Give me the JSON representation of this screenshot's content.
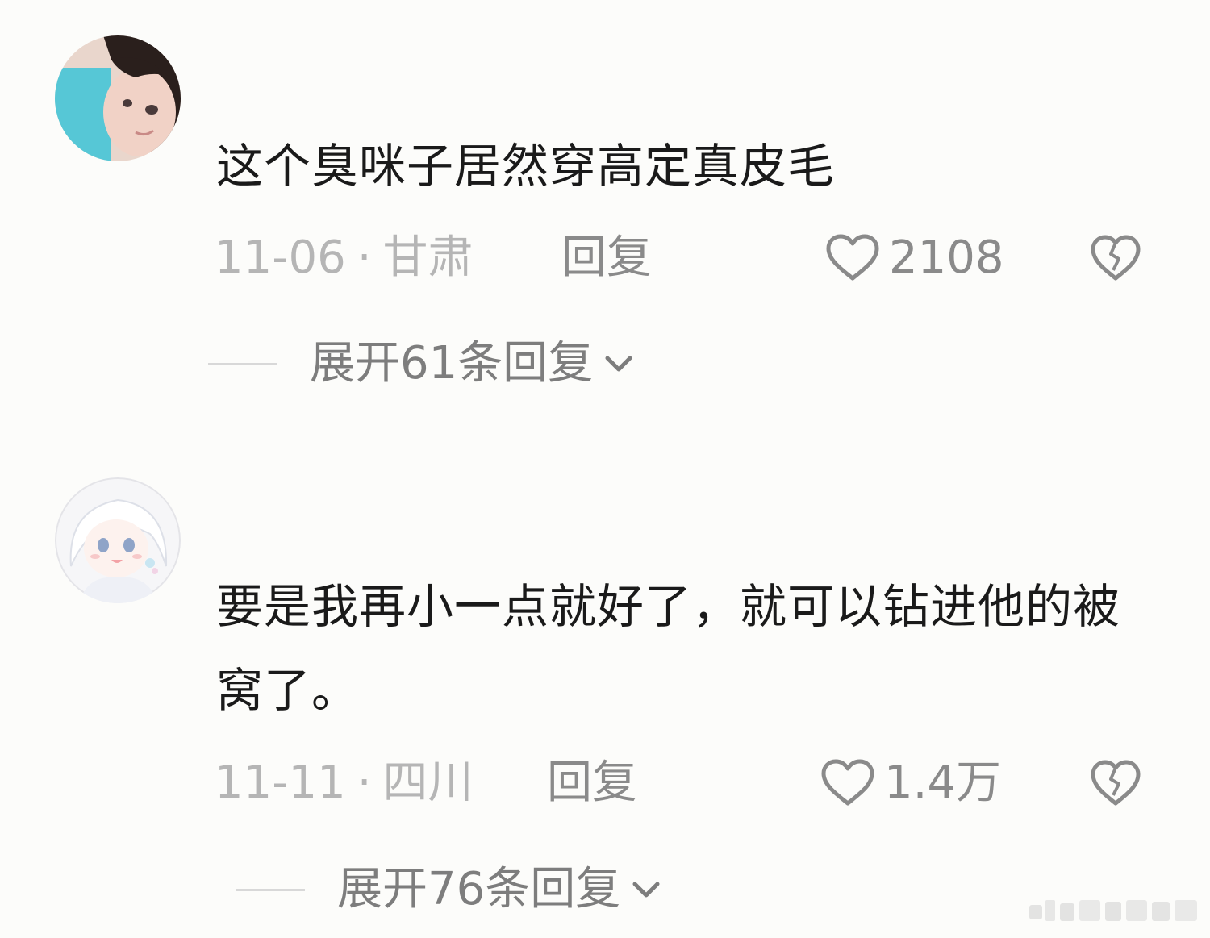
{
  "comments": [
    {
      "text": "这个臭咪子居然穿高定真皮毛",
      "date": "11-06",
      "separator": "·",
      "location": "甘肃",
      "reply_label": "回复",
      "like_count": "2108",
      "expand_label": "展开61条回复"
    },
    {
      "text": "要是我再小一点就好了，就可以钻进他的被窝了。",
      "date": "11-11",
      "separator": "·",
      "location": "四川",
      "reply_label": "回复",
      "like_count": "1.4万",
      "expand_label": "展开76条回复"
    }
  ],
  "icons": {
    "like": "heart-outline-icon",
    "dislike": "broken-heart-icon",
    "expand": "chevron-down-icon"
  },
  "colors": {
    "background": "#fcfcfa",
    "text": "#1a1a1a",
    "meta": "#b5b5b5",
    "action": "#8a8a8a"
  }
}
